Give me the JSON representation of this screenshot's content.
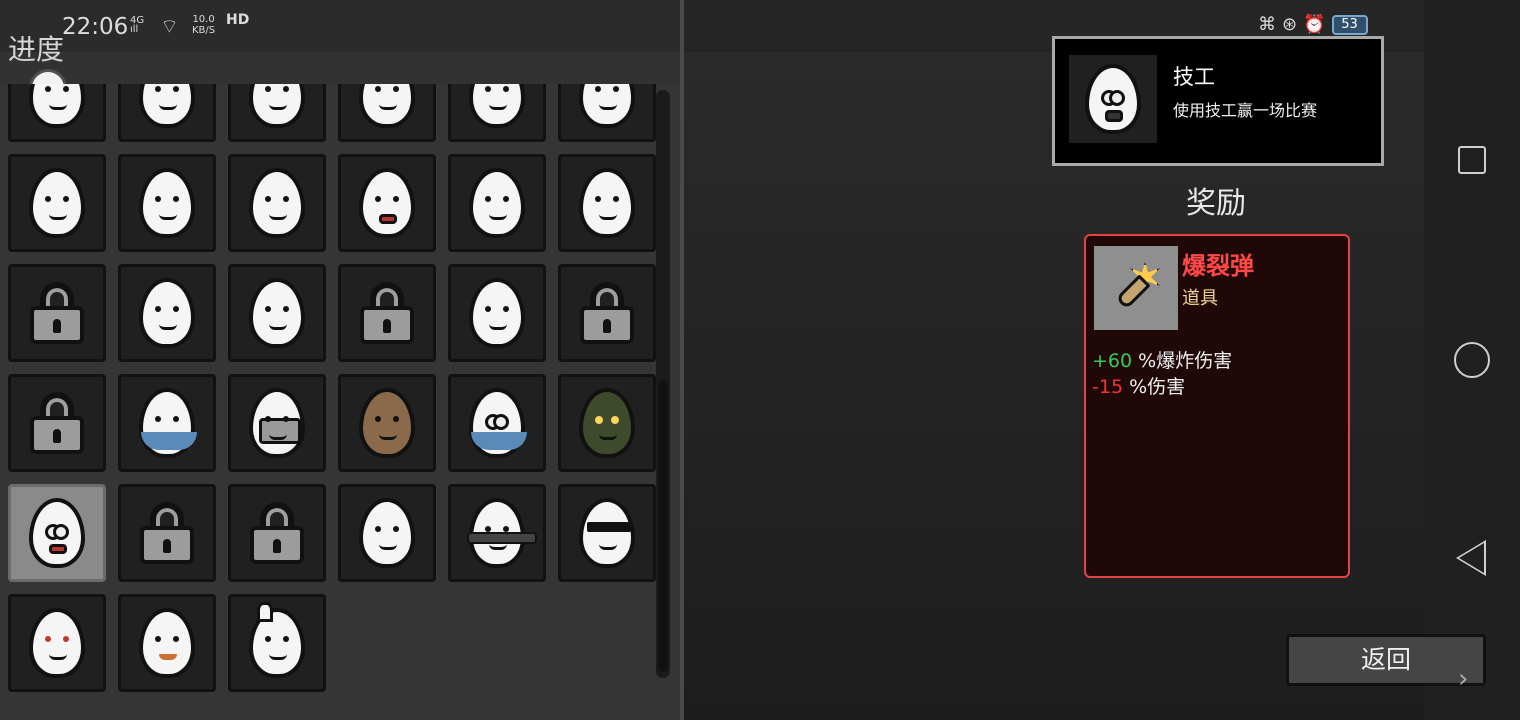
{
  "status_bar": {
    "time": "22:06",
    "net_top": "4G",
    "net_bottom": "ıll",
    "speed_top": "10.0",
    "speed_bottom": "KB/S",
    "hd": "HD",
    "battery": "53"
  },
  "left": {
    "title": "进度",
    "grid_cells": [
      "egg",
      "egg",
      "egg",
      "egg",
      "egg",
      "egg",
      "egg",
      "egg",
      "egg",
      "egg-red",
      "egg",
      "egg",
      "lock",
      "egg",
      "egg",
      "lock",
      "egg",
      "lock",
      "lock",
      "egg-blue",
      "egg-helmet",
      "egg-beard",
      "egg-glasses-scarf",
      "egg-masked",
      "egg-glasses-selected",
      "lock",
      "lock",
      "egg",
      "egg-spiked",
      "egg-sunglasses",
      "egg-angry",
      "egg-mustache",
      "egg-bunny"
    ]
  },
  "achievement": {
    "name": "技工",
    "description": "使用技工赢一场比赛",
    "icon": "glasses-egg-icon"
  },
  "reward": {
    "section_title": "奖励",
    "item_name": "爆裂弹",
    "item_type": "道具",
    "icon": "exploding-bullet-icon",
    "stat1_value": "+60",
    "stat1_label": " %爆炸伤害",
    "stat2_value": "-15",
    "stat2_label": " %伤害"
  },
  "buttons": {
    "back": "返回"
  },
  "colors": {
    "reward_border": "#e24444",
    "positive": "#2fd04d",
    "negative": "#ff2f2f",
    "item_type": "#f0d58f"
  }
}
